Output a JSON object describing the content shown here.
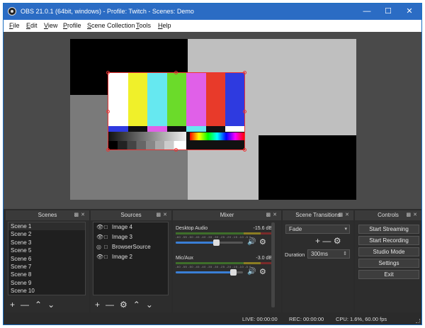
{
  "window": {
    "title": "OBS 21.0.1 (64bit, windows) - Profile: Twitch - Scenes: Demo"
  },
  "menu": [
    {
      "mnemonic": "F",
      "rest": "ile"
    },
    {
      "mnemonic": "E",
      "rest": "dit"
    },
    {
      "mnemonic": "V",
      "rest": "iew"
    },
    {
      "mnemonic": "P",
      "rest": "rofile"
    },
    {
      "mnemonic": "S",
      "rest": "cene Collection"
    },
    {
      "mnemonic": "T",
      "rest": "ools"
    },
    {
      "mnemonic": "H",
      "rest": "elp"
    }
  ],
  "scenes": {
    "title": "Scenes",
    "items": [
      "Scene 1",
      "Scene 2",
      "Scene 3",
      "Scene 5",
      "Scene 6",
      "Scene 7",
      "Scene 8",
      "Scene 9",
      "Scene 10"
    ]
  },
  "sources": {
    "title": "Sources",
    "items": [
      "Image 4",
      "Image 3",
      "BrowserSource",
      "Image 2"
    ]
  },
  "mixer": {
    "title": "Mixer",
    "channels": [
      {
        "name": "Desktop Audio",
        "db": "-15.6 dB",
        "volume_fraction": 0.6
      },
      {
        "name": "Mic/Aux",
        "db": "-3.0 dB",
        "volume_fraction": 0.85
      }
    ],
    "tick_labels": "-60 -55 -50 -45 -40 -35 -30 -25 -20 -15 -10 -5 0"
  },
  "transitions": {
    "title": "Scene Transitions",
    "selected": "Fade",
    "duration_label": "Duration",
    "duration_value": "300ms"
  },
  "controls": {
    "title": "Controls",
    "buttons": [
      "Start Streaming",
      "Start Recording",
      "Studio Mode",
      "Settings",
      "Exit"
    ]
  },
  "status": {
    "live": "LIVE: 00:00:00",
    "rec": "REC: 00:00:00",
    "cpu": "CPU: 1.6%, 60.00 fps"
  },
  "colors": {
    "titlebar": "#2b6cc4",
    "panel": "#2d2d2d",
    "selection_outline": "#e33333"
  }
}
